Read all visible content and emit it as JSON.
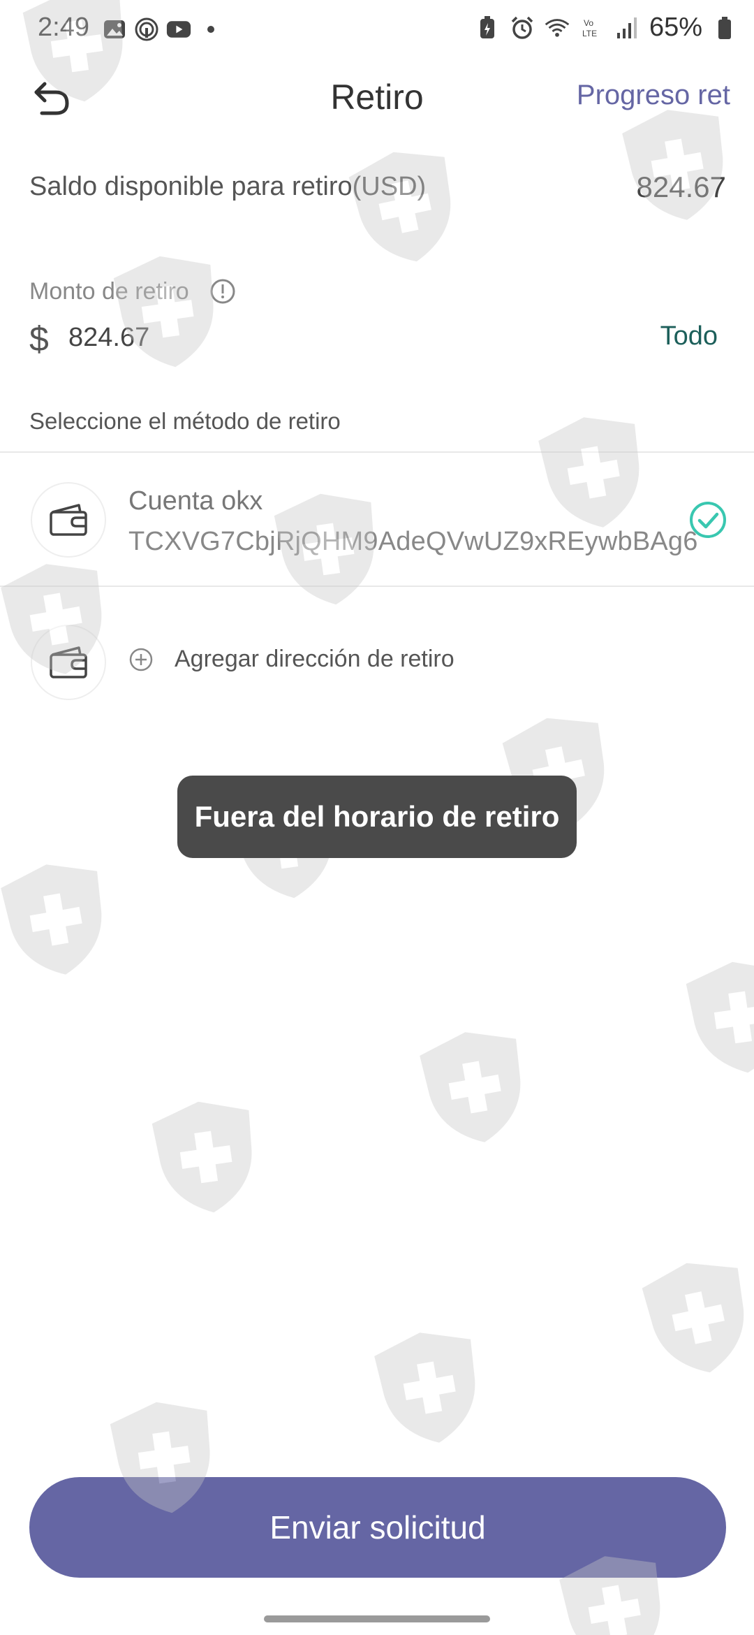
{
  "status_bar": {
    "time": "2:49",
    "battery": "65%",
    "icons_left": [
      "gallery-icon",
      "podcast-icon",
      "youtube-icon",
      "dot-icon"
    ],
    "icons_right": [
      "battery-saver-icon",
      "alarm-icon",
      "wifi-icon",
      "volte-icon",
      "signal-icon",
      "battery-icon"
    ]
  },
  "header": {
    "title": "Retiro",
    "progress_link": "Progreso ret"
  },
  "balance": {
    "label": "Saldo disponible para retiro(USD)",
    "value": "824.67"
  },
  "amount": {
    "label": "Monto de retiro",
    "currency_symbol": "$",
    "value": "824.67",
    "all_button": "Todo"
  },
  "method": {
    "label": "Seleccione el método de retiro",
    "accounts": [
      {
        "name": "Cuenta okx",
        "address": "TCXVG7CbjRjQHM9AdeQVwUZ9xREywbBAg6",
        "selected": true
      }
    ],
    "add_label": "Agregar dirección de retiro"
  },
  "toast": {
    "message": "Fuera del horario de retiro"
  },
  "submit": {
    "label": "Enviar solicitud"
  },
  "colors": {
    "accent": "#6566a4",
    "teal": "#1c5f5a",
    "check": "#39c7b0",
    "toast_bg": "#4a4a4a",
    "watermark": "#c8c8c8"
  }
}
